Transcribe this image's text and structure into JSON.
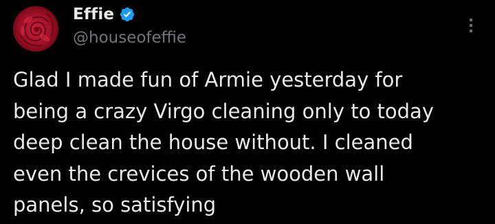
{
  "author": {
    "display_name": "Effie",
    "handle": "@houseofeffie",
    "verified": true,
    "avatar_icon": "red-rose-avatar",
    "verified_icon": "verified-badge-icon"
  },
  "more_options_icon": "more-options-icon",
  "tweet": {
    "text": "Glad I made fun of Armie yesterday for\nbeing a crazy Virgo cleaning only to today\ndeep clean the house without. I cleaned\neven the crevices of the wooden wall\npanels, so satisfying"
  },
  "colors": {
    "background": "#000000",
    "primary_text": "#e7e9ea",
    "secondary_text": "#71767b",
    "verified_blue": "#1d9bf0"
  }
}
